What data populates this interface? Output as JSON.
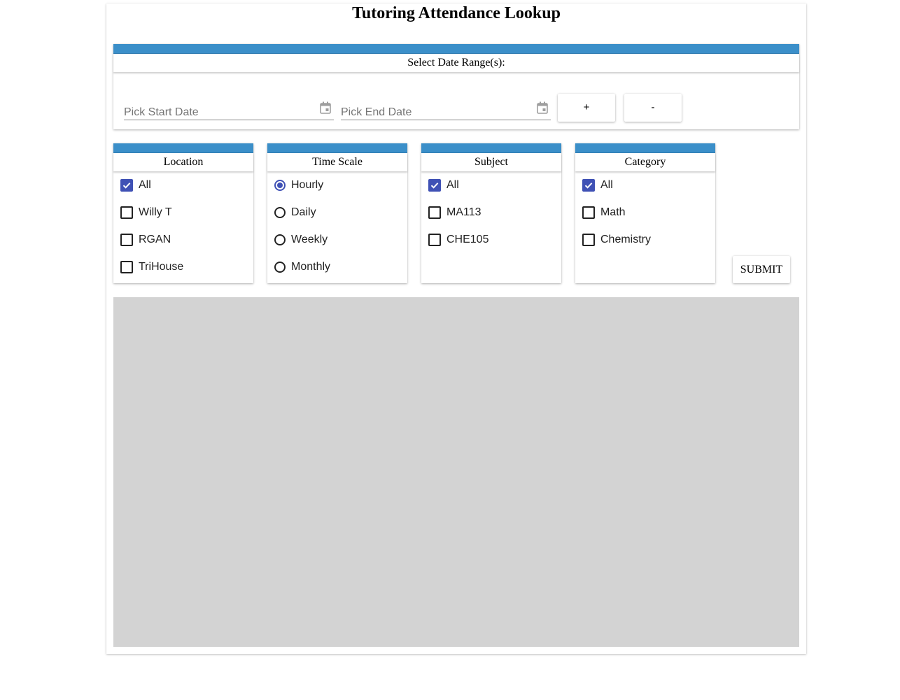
{
  "page": {
    "title": "Tutoring Attendance Lookup"
  },
  "date_range": {
    "header": "Select Date Range(s):",
    "start_placeholder": "Pick Start Date",
    "end_placeholder": "Pick End Date",
    "add_label": "+",
    "remove_label": "-"
  },
  "filters": {
    "location": {
      "header": "Location",
      "type": "checkbox",
      "options": [
        {
          "label": "All",
          "checked": true
        },
        {
          "label": "Willy T",
          "checked": false
        },
        {
          "label": "RGAN",
          "checked": false
        },
        {
          "label": "TriHouse",
          "checked": false
        }
      ]
    },
    "time_scale": {
      "header": "Time Scale",
      "type": "radio",
      "options": [
        {
          "label": "Hourly",
          "checked": true
        },
        {
          "label": "Daily",
          "checked": false
        },
        {
          "label": "Weekly",
          "checked": false
        },
        {
          "label": "Monthly",
          "checked": false
        }
      ]
    },
    "subject": {
      "header": "Subject",
      "type": "checkbox",
      "options": [
        {
          "label": "All",
          "checked": true
        },
        {
          "label": "MA113",
          "checked": false
        },
        {
          "label": "CHE105",
          "checked": false
        }
      ]
    },
    "category": {
      "header": "Category",
      "type": "checkbox",
      "options": [
        {
          "label": "All",
          "checked": true
        },
        {
          "label": "Math",
          "checked": false
        },
        {
          "label": "Chemistry",
          "checked": false
        }
      ]
    }
  },
  "submit_label": "SUBMIT",
  "colors": {
    "header_bar": "#3b8fc9",
    "accent": "#3f51b5",
    "results_background": "#d3d3d3"
  },
  "icons": {
    "date_picker": "calendar-icon",
    "checked_box": "checkmark-icon"
  }
}
